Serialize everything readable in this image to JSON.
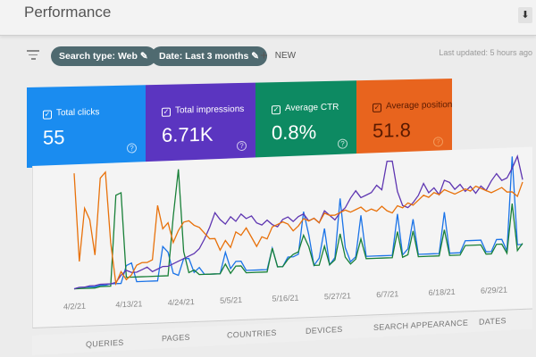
{
  "header": {
    "title": "Performance",
    "download_icon": "download-icon"
  },
  "filters": {
    "chips": [
      {
        "label": "Search type: Web",
        "icon": "pencil-icon"
      },
      {
        "label": "Date: Last 3 months",
        "icon": "pencil-icon"
      }
    ],
    "new_label": "NEW",
    "last_updated": "Last updated: 5 hours ago"
  },
  "cards": [
    {
      "label": "Total clicks",
      "value": "55",
      "color": "#1a8cf0"
    },
    {
      "label": "Total impressions",
      "value": "6.71K",
      "color": "#5b35c0"
    },
    {
      "label": "Average CTR",
      "value": "0.8%",
      "color": "#0d8a62"
    },
    {
      "label": "Average position",
      "value": "51.8",
      "color": "#e8641e"
    }
  ],
  "chart_data": {
    "type": "line",
    "x_ticks": [
      "4/2/21",
      "4/13/21",
      "4/24/21",
      "5/5/21",
      "5/16/21",
      "5/27/21",
      "6/7/21",
      "6/18/21",
      "6/29/21"
    ],
    "ylim": [
      0,
      100
    ],
    "grid": false,
    "series": [
      {
        "color": "#1a73e8",
        "values": [
          2,
          3,
          3,
          3,
          3,
          4,
          4,
          5,
          5,
          5,
          20,
          22,
          6,
          6,
          6,
          6,
          6,
          35,
          30,
          12,
          10,
          24,
          24,
          12,
          16,
          10,
          10,
          10,
          10,
          28,
          14,
          20,
          20,
          12,
          12,
          12,
          12,
          12,
          30,
          14,
          14,
          22,
          22,
          24,
          60,
          40,
          14,
          20,
          45,
          14,
          20,
          70,
          28,
          16,
          20,
          55,
          20,
          20,
          20,
          20,
          20,
          20,
          55,
          20,
          25,
          50,
          20,
          20,
          20,
          20,
          20,
          55,
          20,
          20,
          20,
          30,
          30,
          30,
          30,
          20,
          20,
          30,
          30,
          20,
          100,
          25,
          25
        ]
      },
      {
        "color": "#188038",
        "values": [
          2,
          2,
          2,
          2,
          2,
          3,
          3,
          3,
          80,
          82,
          10,
          10,
          10,
          10,
          10,
          10,
          10,
          10,
          10,
          60,
          100,
          30,
          12,
          14,
          10,
          10,
          10,
          10,
          10,
          18,
          10,
          16,
          16,
          10,
          10,
          10,
          10,
          10,
          30,
          14,
          14,
          20,
          24,
          26,
          40,
          30,
          14,
          14,
          30,
          14,
          18,
          40,
          20,
          14,
          18,
          35,
          18,
          18,
          18,
          18,
          18,
          18,
          40,
          18,
          20,
          40,
          18,
          18,
          18,
          18,
          18,
          40,
          18,
          18,
          18,
          26,
          26,
          26,
          26,
          18,
          18,
          26,
          26,
          18,
          60,
          20,
          26
        ]
      },
      {
        "color": "#5e35b1",
        "values": [
          2,
          3,
          3,
          4,
          4,
          5,
          5,
          5,
          6,
          12,
          16,
          14,
          14,
          16,
          18,
          14,
          16,
          18,
          18,
          20,
          22,
          24,
          26,
          28,
          32,
          40,
          50,
          62,
          56,
          52,
          58,
          54,
          60,
          56,
          58,
          52,
          50,
          54,
          50,
          48,
          54,
          56,
          52,
          56,
          58,
          52,
          54,
          50,
          60,
          56,
          52,
          58,
          62,
          70,
          76,
          70,
          72,
          74,
          80,
          76,
          100,
          100,
          74,
          62,
          60,
          64,
          70,
          80,
          72,
          76,
          70,
          82,
          80,
          74,
          78,
          72,
          76,
          70,
          76,
          72,
          80,
          86,
          80,
          82,
          90,
          100,
          80
        ]
      },
      {
        "color": "#e8710a",
        "values": [
          100,
          25,
          70,
          60,
          30,
          95,
          100,
          40,
          5,
          15,
          8,
          12,
          20,
          22,
          22,
          24,
          70,
          50,
          55,
          38,
          48,
          55,
          56,
          52,
          50,
          45,
          40,
          40,
          30,
          38,
          32,
          45,
          42,
          48,
          40,
          32,
          40,
          38,
          48,
          50,
          52,
          50,
          44,
          48,
          54,
          52,
          54,
          50,
          58,
          56,
          56,
          58,
          60,
          58,
          60,
          62,
          58,
          60,
          58,
          62,
          58,
          56,
          62,
          60,
          64,
          62,
          66,
          70,
          68,
          72,
          70,
          74,
          72,
          70,
          72,
          74,
          72,
          76,
          74,
          72,
          70,
          72,
          74,
          70,
          70,
          66,
          78
        ]
      }
    ]
  },
  "tabs": [
    "QUERIES",
    "PAGES",
    "COUNTRIES",
    "DEVICES",
    "SEARCH APPEARANCE",
    "DATES"
  ]
}
